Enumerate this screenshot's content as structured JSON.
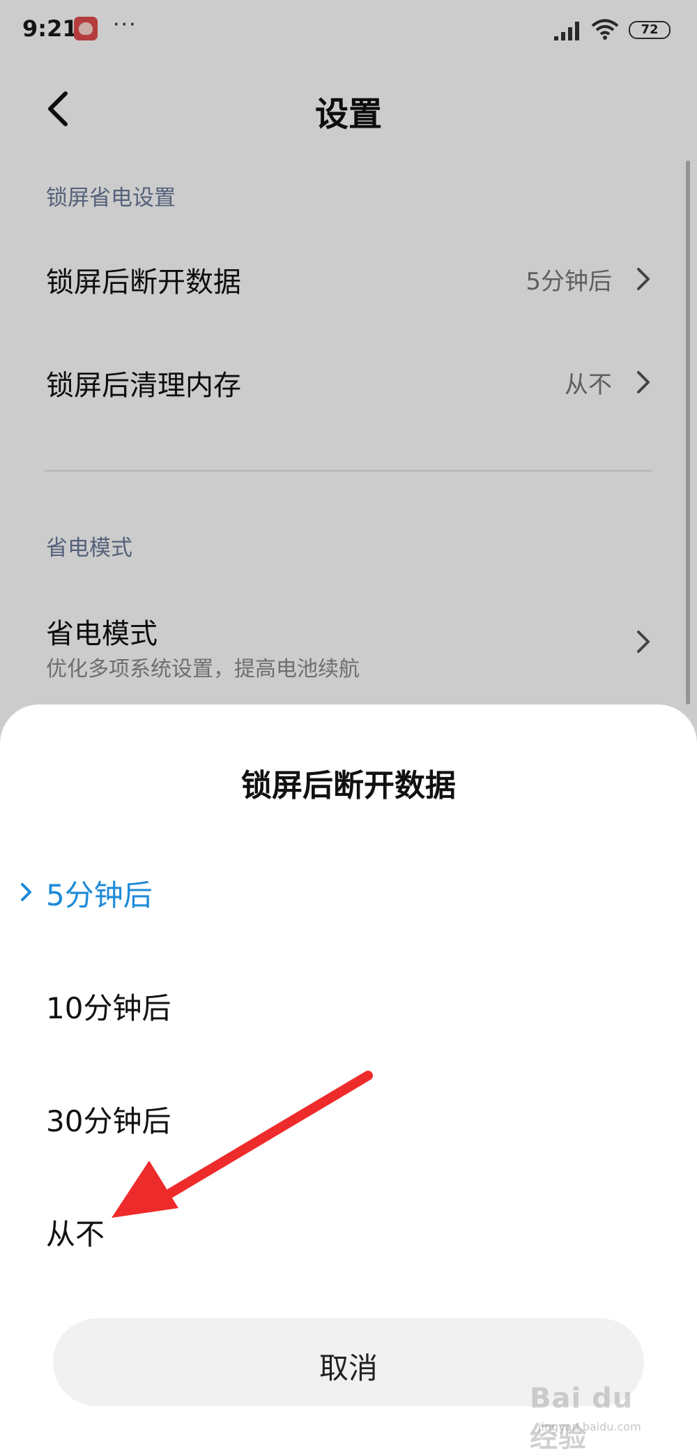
{
  "status_bar": {
    "time": "9:21",
    "dots": "···",
    "battery": "72"
  },
  "header": {
    "title": "设置"
  },
  "sections": [
    {
      "label": "锁屏省电设置",
      "rows": [
        {
          "title": "锁屏后断开数据",
          "value": "5分钟后"
        },
        {
          "title": "锁屏后清理内存",
          "value": "从不"
        }
      ]
    },
    {
      "label": "省电模式",
      "rows": [
        {
          "title": "省电模式",
          "subtitle": "优化多项系统设置，提高电池续航"
        }
      ]
    }
  ],
  "sheet": {
    "title": "锁屏后断开数据",
    "options": [
      {
        "label": "5分钟后",
        "selected": true
      },
      {
        "label": "10分钟后",
        "selected": false
      },
      {
        "label": "30分钟后",
        "selected": false
      },
      {
        "label": "从不",
        "selected": false
      }
    ],
    "cancel_label": "取消"
  },
  "watermark": {
    "text": "Bai du 经验",
    "url": "jingyan.baidu.com"
  },
  "colors": {
    "accent": "#1e8ad8",
    "section_label": "#6b7a99",
    "arrow": "#ee2b2b"
  }
}
